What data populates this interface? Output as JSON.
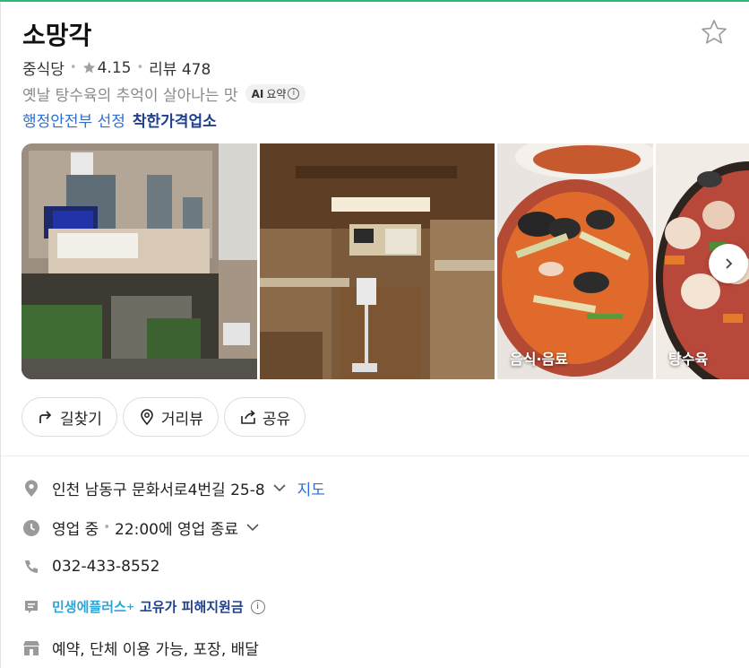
{
  "place": {
    "name": "소망각",
    "category": "중식당",
    "rating": "4.15",
    "review_label": "리뷰",
    "review_count": "478",
    "summary": "옛날 탕수육의 추억이 살아나는 맛",
    "ai_badge_label": "AI",
    "ai_badge_text": "요약",
    "gov_label": "행정안전부 선정",
    "gov_highlight": "착한가격업소"
  },
  "photos": [
    {
      "alt": "storefront",
      "label": ""
    },
    {
      "alt": "interior",
      "label": ""
    },
    {
      "alt": "jjamppong",
      "label": "음식·음료"
    },
    {
      "alt": "tangsuyuk",
      "label": "탕수육"
    }
  ],
  "actions": [
    {
      "label": "길찾기",
      "icon": "directions-icon"
    },
    {
      "label": "거리뷰",
      "icon": "streetview-pin-icon"
    },
    {
      "label": "공유",
      "icon": "share-icon"
    }
  ],
  "details": {
    "address": "인천 남동구 문화서로4번길 25-8",
    "map_link": "지도",
    "hours_status": "영업 중",
    "hours_detail": "22:00에 영업 종료",
    "phone": "032-433-8552",
    "promo_brand": "민생에플러스",
    "promo_text": "고유가 피해지원금",
    "amenities": "예약, 단체 이용 가능, 포장, 배달"
  },
  "colors": {
    "link": "#2b6fd6",
    "gov_highlight": "#1f3f8f",
    "promo": "#2aa7d8",
    "top_line": "#2db87b"
  }
}
